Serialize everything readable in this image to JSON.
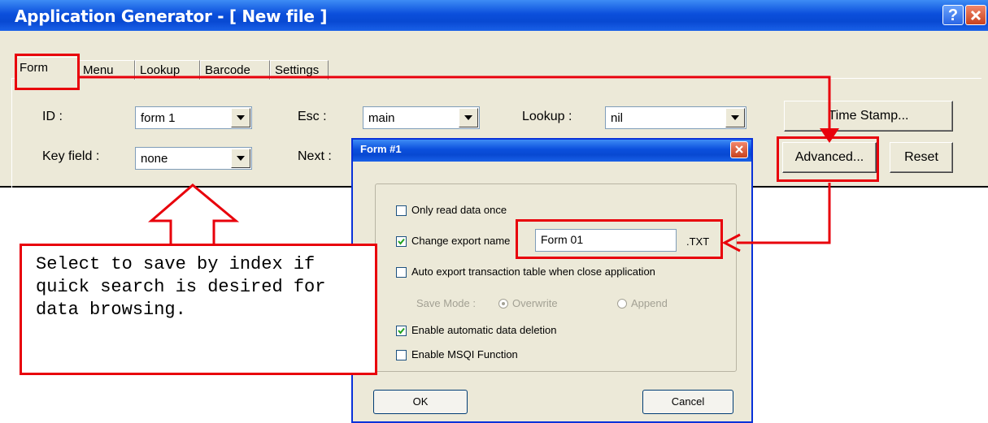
{
  "window": {
    "title": "Application Generator - [ New file ]",
    "help_glyph": "?",
    "close_glyph": "X"
  },
  "tabs": [
    {
      "label": "Form",
      "active": true
    },
    {
      "label": "Menu",
      "active": false
    },
    {
      "label": "Lookup",
      "active": false
    },
    {
      "label": "Barcode",
      "active": false
    },
    {
      "label": "Settings",
      "active": false
    }
  ],
  "form": {
    "id_label": "ID :",
    "id_value": "form 1",
    "key_field_label": "Key field :",
    "key_field_value": "none",
    "esc_label": "Esc :",
    "esc_value": "main",
    "next_label": "Next :",
    "lookup_label": "Lookup :",
    "lookup_value": "nil",
    "time_stamp_button": "Time Stamp...",
    "advanced_button": "Advanced...",
    "reset_button": "Reset"
  },
  "dialog": {
    "title": "Form #1",
    "close_glyph": "X",
    "only_read_once": {
      "label": "Only read data once",
      "checked": false
    },
    "change_export_name": {
      "label": "Change export name",
      "checked": true
    },
    "export_name_value": "Form 01",
    "export_ext": ".TXT",
    "auto_export": {
      "label": "Auto export transaction table when close application",
      "checked": false
    },
    "save_mode_label": "Save Mode :",
    "save_mode_overwrite": "Overwrite",
    "save_mode_append": "Append",
    "auto_delete": {
      "label": "Enable automatic data deletion",
      "checked": true
    },
    "msqi": {
      "label": "Enable MSQI Function",
      "checked": false
    },
    "ok_button": "OK",
    "cancel_button": "Cancel"
  },
  "annotation": {
    "callout_text": "Select to save by index if quick search is desired for data browsing.",
    "highlight_color": "#e8000b"
  }
}
